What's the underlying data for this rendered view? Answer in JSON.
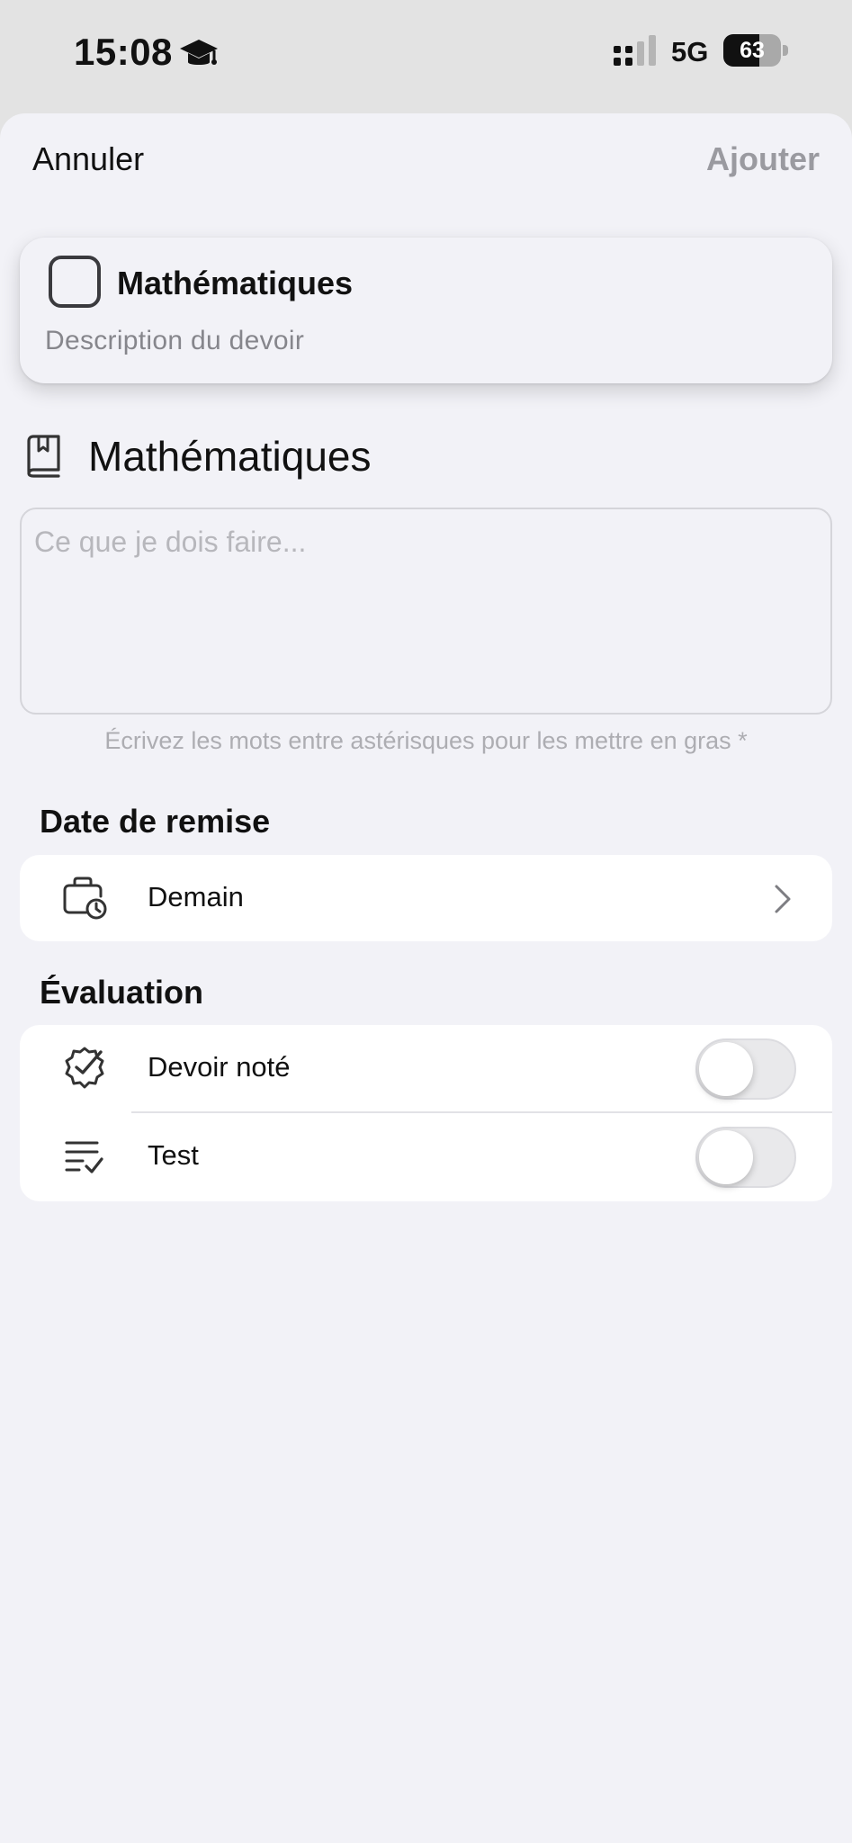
{
  "status_bar": {
    "time": "15:08",
    "network": "5G",
    "battery": "63",
    "battery_level": 0.63,
    "left_icon": "graduation-cap-icon"
  },
  "nav": {
    "cancel_label": "Annuler",
    "add_label": "Ajouter"
  },
  "preview": {
    "title": "Mathématiques",
    "description": "Description du devoir"
  },
  "subject": {
    "icon": "book-icon",
    "name": "Mathématiques"
  },
  "homework": {
    "placeholder": "Ce que je dois faire...",
    "hint": "Écrivez les mots entre astérisques pour les mettre en gras *"
  },
  "due_date": {
    "section_title": "Date de remise",
    "icon": "briefcase-clock-icon",
    "value": "Demain"
  },
  "evaluation": {
    "section_title": "Évaluation",
    "items": [
      {
        "label": "Devoir noté",
        "icon": "badge-check-icon",
        "enabled": false
      },
      {
        "label": "Test",
        "icon": "list-check-icon",
        "enabled": false
      }
    ]
  },
  "colors": {
    "sheet_background": "#f2f2f7",
    "status_background": "#e3e3e3",
    "disabled_action": "#9a9aa0",
    "placeholder": "#b7b7bc"
  }
}
